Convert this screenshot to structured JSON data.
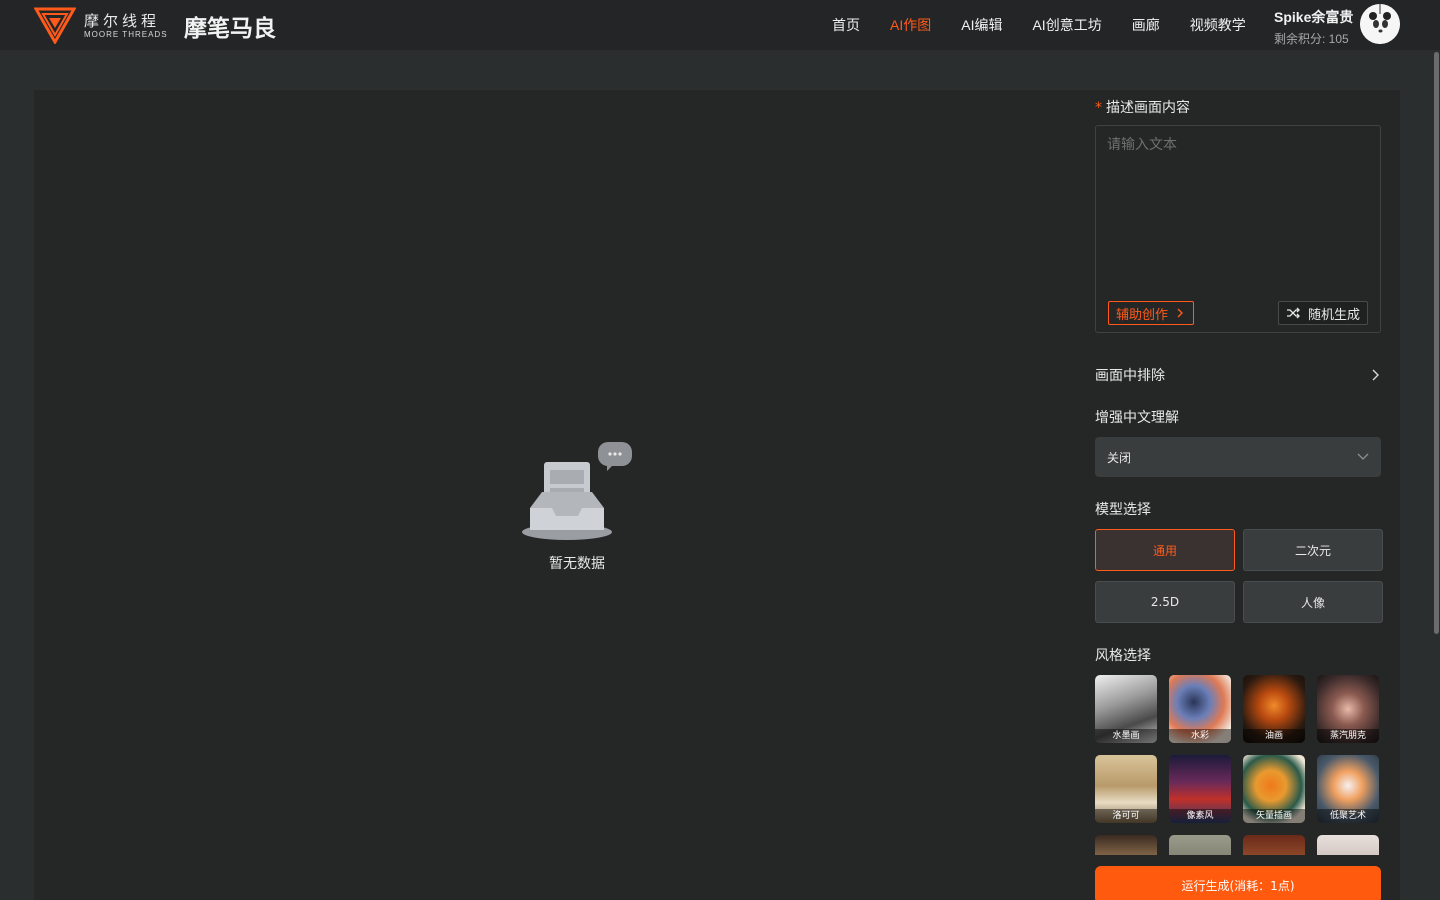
{
  "header": {
    "brand_cn": "摩尔线程",
    "brand_en": "MOORE THREADS",
    "site_title": "摩笔马良",
    "nav": [
      "首页",
      "AI作图",
      "AI编辑",
      "AI创意工坊",
      "画廊",
      "视频教学"
    ],
    "active_nav": "AI作图",
    "user_name": "Spike余富贵",
    "user_points": "剩余积分: 105"
  },
  "empty_state": {
    "text": "暂无数据"
  },
  "panel": {
    "prompt_label": "描述画面内容",
    "required_mark": "*",
    "prompt_placeholder": "请输入文本",
    "assist_label": "辅助创作",
    "random_label": "随机生成",
    "exclude_label": "画面中排除",
    "enhance_label": "增强中文理解",
    "enhance_value": "关闭",
    "model_label": "模型选择",
    "models": [
      "通用",
      "二次元",
      "2.5D",
      "人像"
    ],
    "active_model": "通用",
    "style_label": "风格选择",
    "styles": [
      "水墨画",
      "水彩",
      "油画",
      "蒸汽朋克",
      "洛可可",
      "像素风",
      "矢量插画",
      "低聚艺术"
    ],
    "run_label": "运行生成(消耗：1点)"
  },
  "colors": {
    "accent": "#ff5a1a",
    "header_bg": "#232526",
    "panel_bg": "#252727",
    "page_bg": "#2b2e2f"
  }
}
